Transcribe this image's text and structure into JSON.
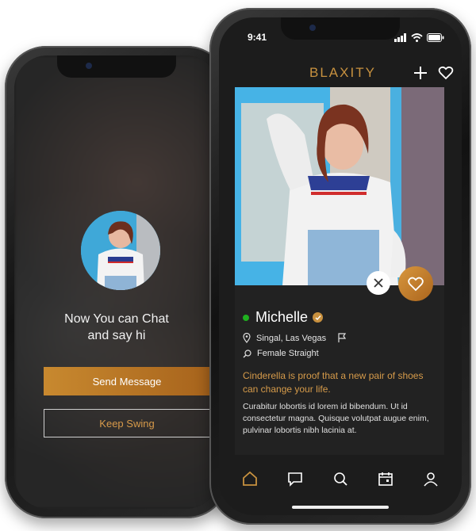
{
  "back_phone": {
    "match_text_line1": "Now You can Chat",
    "match_text_line2": "and say hi",
    "send_message_label": "Send Message",
    "keep_swing_label": "Keep Swing"
  },
  "front_phone": {
    "status": {
      "time": "9:41"
    },
    "app_bar": {
      "brand": "BLAXITY",
      "add_icon": "plus-icon",
      "favorites_icon": "heart-outline-icon"
    },
    "profile": {
      "name": "Michelle",
      "online_status_color": "#1fb01f",
      "location": "Singal, Las Vegas",
      "preference": "Female Straight",
      "quote": "Cinderella is proof that a new pair of shoes can change your life.",
      "bio": "Curabitur lobortis id lorem id bibendum. Ut id consectetur magna. Quisque volutpat augue enim, pulvinar lobortis nibh lacinia at."
    },
    "tab_bar": [
      "home-icon",
      "chat-icon",
      "search-icon",
      "calendar-icon",
      "profile-icon"
    ]
  },
  "colors": {
    "accent": "#c7913f",
    "background": "#1c1c1c",
    "card": "#222222"
  }
}
